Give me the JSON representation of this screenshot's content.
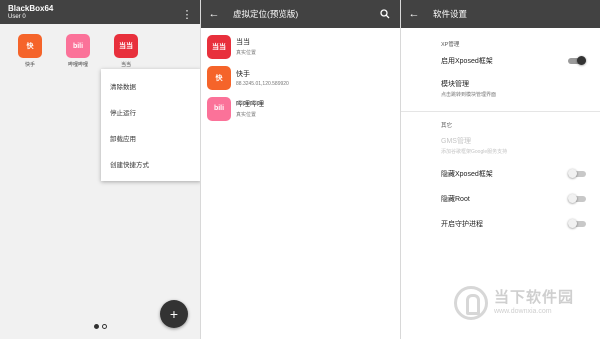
{
  "screen1": {
    "app_title": "BlackBox64",
    "user": "User 0",
    "apps": [
      {
        "label": "快手",
        "icon": "kuaishou-icon",
        "color": "#f5642a",
        "glyph": "快"
      },
      {
        "label": "哔哩哔哩",
        "icon": "bilibili-icon",
        "color": "#fb7299",
        "glyph": "bili"
      },
      {
        "label": "当当",
        "icon": "dangdang-icon",
        "color": "#e8303c",
        "glyph": "当当"
      }
    ],
    "menu": [
      "清除数据",
      "停止运行",
      "卸载应用",
      "创建快捷方式"
    ],
    "fab": "+"
  },
  "screen2": {
    "title": "虚拟定位(预览版)",
    "items": [
      {
        "name": "当当",
        "sub": "真实位置",
        "color": "#e8303c",
        "glyph": "当当",
        "icon": "dangdang-icon"
      },
      {
        "name": "快手",
        "sub": "88.3245.01,120.589920",
        "color": "#f5642a",
        "glyph": "快",
        "icon": "kuaishou-icon"
      },
      {
        "name": "哔哩哔哩",
        "sub": "真实位置",
        "color": "#fb7299",
        "glyph": "bili",
        "icon": "bilibili-icon"
      }
    ]
  },
  "screen3": {
    "title": "软件设置",
    "section1": "XP管理",
    "enable_xposed": "启用Xposed框架",
    "module_mgmt": "模块管理",
    "module_mgmt_sub": "点击跳转到模块管理界面",
    "section2": "其它",
    "gms_label": "GMS管理",
    "gms_sub": "添加谷歌框架Google服务支持",
    "hide_xposed": "隐藏Xposed框架",
    "hide_root": "隐藏Root",
    "daemon": "开启守护进程"
  },
  "watermark": {
    "title": "当下软件园",
    "url": "www.downxia.com"
  }
}
